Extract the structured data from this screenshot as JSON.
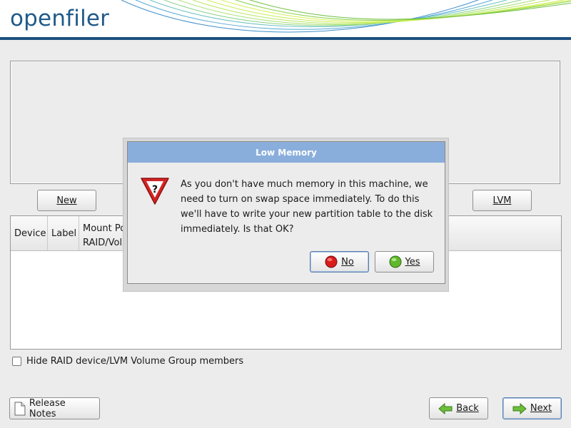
{
  "header": {
    "logo_text": "openfiler"
  },
  "toolbar": {
    "new_label": "New",
    "lvm_label": "LVM"
  },
  "table": {
    "columns": [
      "Device",
      "Label",
      "Mount Point/",
      "RAID/Volume"
    ]
  },
  "options": {
    "hide_members_label": "Hide RAID device/LVM Volume Group members"
  },
  "footer": {
    "release_notes_label": "Release Notes",
    "back_label": "Back",
    "next_label": "Next"
  },
  "dialog": {
    "title": "Low Memory",
    "message": "As you don't have much memory in this machine, we need to turn on swap space immediately. To do this we'll have to write your new partition table to the disk immediately. Is that OK?",
    "no_label": "No",
    "yes_label": "Yes"
  },
  "colors": {
    "header_bar": "#1e4f80",
    "dialog_title": "#8aaedb",
    "logo": "#1f5a8a"
  }
}
